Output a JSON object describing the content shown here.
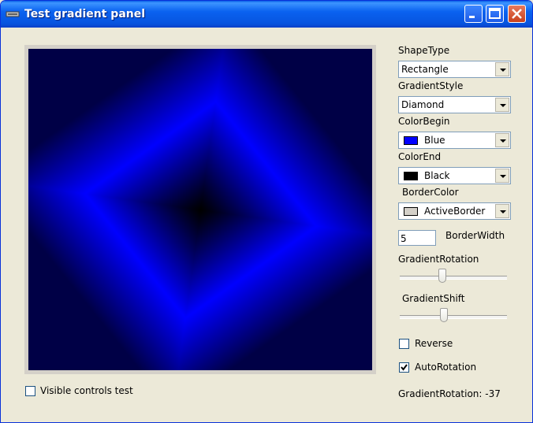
{
  "window": {
    "title": "Test gradient panel"
  },
  "panel": {
    "color_begin": "#0000ff",
    "color_end": "#000000",
    "border_color": "#d4d0c8",
    "gradient_style": "Diamond"
  },
  "controls": {
    "shape_type": {
      "label": "ShapeType",
      "value": "Rectangle"
    },
    "gradient_style": {
      "label": "GradientStyle",
      "value": "Diamond"
    },
    "color_begin": {
      "label": "ColorBegin",
      "value": "Blue",
      "swatch": "#0000ff"
    },
    "color_end": {
      "label": "ColorEnd",
      "value": "Black",
      "swatch": "#000000"
    },
    "border_color": {
      "label": "BorderColor",
      "value": "ActiveBorder",
      "swatch": "#d4d0c8"
    },
    "border_width": {
      "label": "BorderWidth",
      "value": "5"
    },
    "gradient_rotation": {
      "label": "GradientRotation",
      "slider_fraction": 0.4
    },
    "gradient_shift": {
      "label": "GradientShift",
      "slider_fraction": 0.41
    },
    "reverse": {
      "label": "Reverse",
      "checked": false
    },
    "auto_rotation": {
      "label": "AutoRotation",
      "checked": true
    },
    "visible_controls_test": {
      "label": "Visible controls test",
      "checked": false
    },
    "status": "GradientRotation: -37"
  }
}
